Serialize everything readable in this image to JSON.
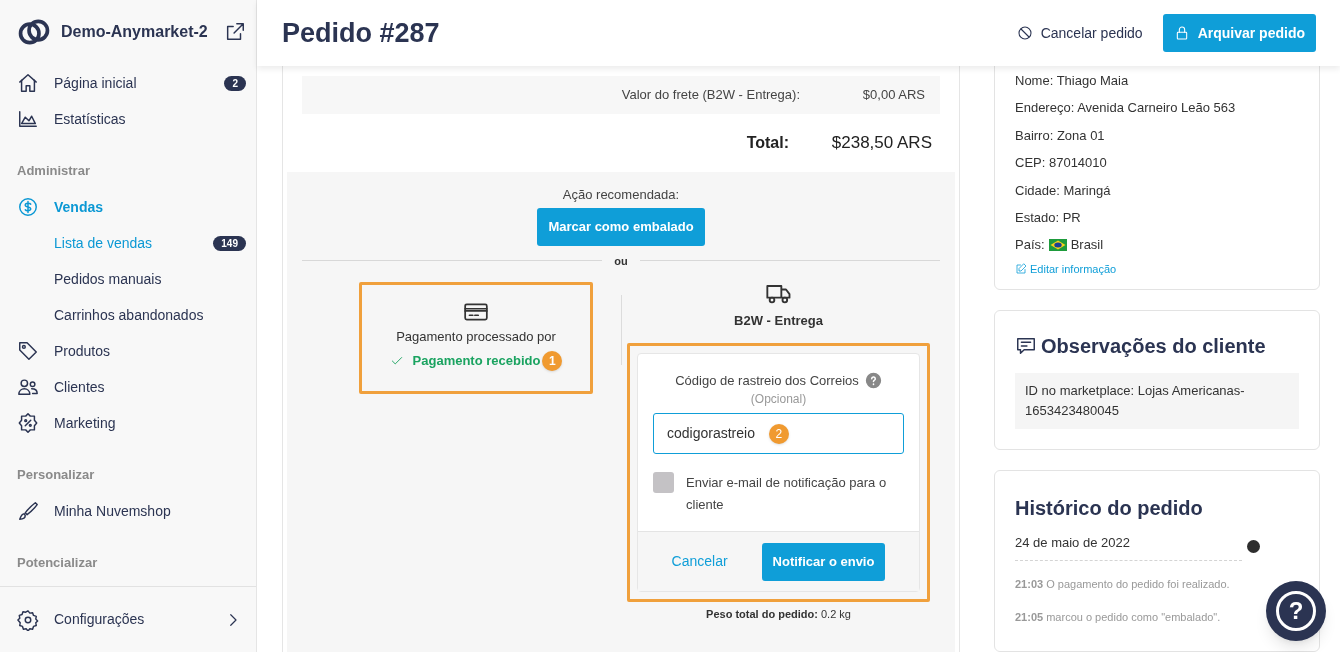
{
  "sidebar": {
    "store_name": "Demo-Anymarket-2",
    "nav": [
      {
        "kind": "item",
        "label": "Página inicial",
        "badge": "2",
        "selected": false
      },
      {
        "kind": "item",
        "label": "Estatísticas",
        "selected": false
      },
      {
        "kind": "section",
        "label": "Administrar"
      },
      {
        "kind": "item",
        "label": "Vendas",
        "selected": true
      },
      {
        "kind": "subitem",
        "label": "Lista de vendas",
        "badge": "149",
        "selected": true
      },
      {
        "kind": "subitem",
        "label": "Pedidos manuais",
        "selected": false
      },
      {
        "kind": "subitem",
        "label": "Carrinhos abandonados",
        "selected": false
      },
      {
        "kind": "item",
        "label": "Produtos",
        "selected": false
      },
      {
        "kind": "item",
        "label": "Clientes",
        "selected": false
      },
      {
        "kind": "item",
        "label": "Marketing",
        "selected": false
      },
      {
        "kind": "section",
        "label": "Personalizar"
      },
      {
        "kind": "item",
        "label": "Minha Nuvemshop",
        "selected": false
      },
      {
        "kind": "section",
        "label": "Potencializar"
      }
    ],
    "settings": "Configurações"
  },
  "header": {
    "title": "Pedido #287",
    "cancel": "Cancelar pedido",
    "archive": "Arquivar pedido"
  },
  "totals": {
    "shipping_label": "Valor do frete (B2W - Entrega):",
    "shipping_value": "$0,00 ARS",
    "total_label": "Total:",
    "total_value": "$238,50 ARS"
  },
  "actions": {
    "recommended_label": "Ação recomendada:",
    "recommended_button": "Marcar como embalado",
    "or": "ou",
    "payment": {
      "label": "Pagamento processado por",
      "status": "Pagamento recebido",
      "marker": "1"
    },
    "shipping": {
      "carrier": "B2W - Entrega",
      "tracking_label": "Código de rastreio dos Correios",
      "optional": "(Opcional)",
      "tracking_value": "codigorastreio",
      "marker": "2",
      "notify_label": "Enviar e-mail de notificação para o cliente",
      "notify_checked": false,
      "cancel": "Cancelar",
      "submit": "Notificar o envio"
    },
    "weight_label": "Peso total do pedido:",
    "weight_value": "0.2 kg"
  },
  "customer": {
    "lines": [
      "Nome: Thiago Maia",
      "Endereço: Avenida Carneiro Leão 563",
      "Bairro: Zona 01",
      "CEP: 87014010",
      "Cidade: Maringá",
      "Estado: PR"
    ],
    "country_label": "País:",
    "country": "Brasil",
    "edit": "Editar informação"
  },
  "notes": {
    "title": "Observações do cliente",
    "text": "ID no marketplace: Lojas Americanas-1653423480045"
  },
  "history": {
    "title": "Histórico do pedido",
    "date": "24 de maio de 2022",
    "events": [
      {
        "time": "21:03",
        "text": "O pagamento do pedido foi realizado."
      },
      {
        "time": "21:05",
        "text": "marcou o pedido como \"embalado\"."
      }
    ]
  },
  "help_button": "?"
}
